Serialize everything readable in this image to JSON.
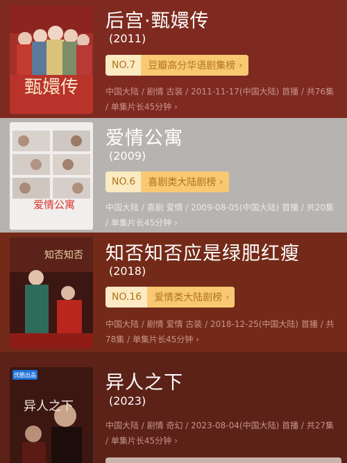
{
  "items": [
    {
      "title": "后宫·甄嬛传",
      "year": "(2011)",
      "rank_no": "NO.7",
      "rank_name": "豆瓣高分华语剧集榜",
      "meta": "中国大陆 / 剧情 古装 / 2011-11-17(中国大陆) 首播 / 共76集 / 单集片长45分钟",
      "poster_title": "甄嬛传"
    },
    {
      "title": "爱情公寓",
      "year": "(2009)",
      "rank_no": "NO.6",
      "rank_name": "喜剧类大陆剧榜",
      "meta": "中国大陆 / 喜剧 爱情 / 2009-08-05(中国大陆) 首播 / 共20集 / 单集片长45分钟",
      "poster_title": "爱情公寓"
    },
    {
      "title": "知否知否应是绿肥红瘦",
      "year": "(2018)",
      "rank_no": "NO.16",
      "rank_name": "爱情类大陆剧榜",
      "meta": "中国大陆 / 剧情 爱情 古装 / 2018-12-25(中国大陆) 首播 / 共78集 / 单集片长45分钟",
      "poster_title": "知否知否"
    },
    {
      "title": "异人之下",
      "year": "(2023)",
      "rank_no": "",
      "rank_name": "",
      "meta": "中国大陆 / 剧情 奇幻 / 2023-08-04(中国大陆) 首播 / 共27集 / 单集片长45分钟",
      "poster_title": "异人之下",
      "poster_badge": "优酷出品"
    }
  ],
  "colors": {
    "card1": "#7e2a20",
    "card2": "#b7b3b1",
    "card3": "#742a18",
    "card4": "#5c2218",
    "rank_bg": "#fbeac2",
    "rank_name_bg": "#f8c972",
    "rank_text": "#b0741c"
  },
  "icons": {
    "chevron": "chevron-right-icon"
  }
}
